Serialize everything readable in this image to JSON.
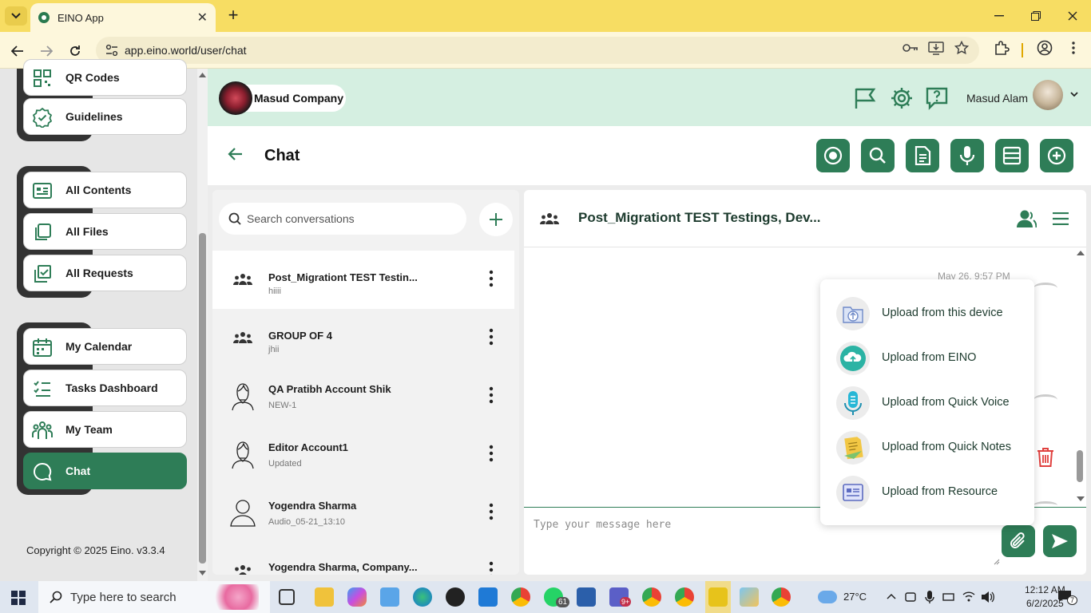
{
  "browser": {
    "tab_title": "EINO App",
    "url": "app.eino.world/user/chat"
  },
  "sidebar": {
    "items": [
      {
        "label": "QR Codes",
        "icon": "qr-code-icon"
      },
      {
        "label": "Guidelines",
        "icon": "check-badge-icon"
      },
      {
        "label": "All Contents",
        "icon": "contents-icon"
      },
      {
        "label": "All Files",
        "icon": "files-icon"
      },
      {
        "label": "All Requests",
        "icon": "requests-icon"
      },
      {
        "label": "My Calendar",
        "icon": "calendar-icon"
      },
      {
        "label": "Tasks Dashboard",
        "icon": "tasks-icon"
      },
      {
        "label": "My Team",
        "icon": "team-icon"
      },
      {
        "label": "Chat",
        "icon": "chat-icon",
        "active": true
      }
    ],
    "copyright": "Copyright © 2025 Eino. v3.3.4"
  },
  "header": {
    "company": "Masud Company",
    "user_name": "Masud Alam"
  },
  "page": {
    "title": "Chat"
  },
  "conversations": {
    "search_placeholder": "Search conversations",
    "items": [
      {
        "name": "Post_Migrationt TEST Testin...",
        "preview": "hiiii",
        "type": "group"
      },
      {
        "name": "GROUP OF 4",
        "preview": "jhii",
        "type": "group"
      },
      {
        "name": "QA Pratibh Account Shik",
        "preview": "NEW-1",
        "type": "female"
      },
      {
        "name": "Editor Account1",
        "preview": "Updated",
        "type": "female"
      },
      {
        "name": "Yogendra Sharma",
        "preview": "Audio_05-21_13:10",
        "type": "person"
      },
      {
        "name": "Yogendra Sharma, Company...",
        "preview": "",
        "type": "group"
      }
    ]
  },
  "chat": {
    "title": "Post_Migrationt TEST Testings, Dev...",
    "date_label": "May 26, 9:57 PM",
    "input_placeholder": "Type your message here"
  },
  "upload_menu": {
    "items": [
      {
        "label": "Upload from this device",
        "icon": "folder-upload-icon"
      },
      {
        "label": "Upload from EINO",
        "icon": "cloud-upload-icon"
      },
      {
        "label": "Upload from Quick Voice",
        "icon": "microphone-icon"
      },
      {
        "label": "Upload from Quick Notes",
        "icon": "notes-icon"
      },
      {
        "label": "Upload from Resource",
        "icon": "resource-icon"
      }
    ]
  },
  "taskbar": {
    "search_placeholder": "Type here to search",
    "weather": "27°C",
    "time": "12:12 AM",
    "date": "6/2/2025",
    "whatsapp_badge": "61",
    "teams_badge": "9+",
    "notification_count": "7"
  }
}
